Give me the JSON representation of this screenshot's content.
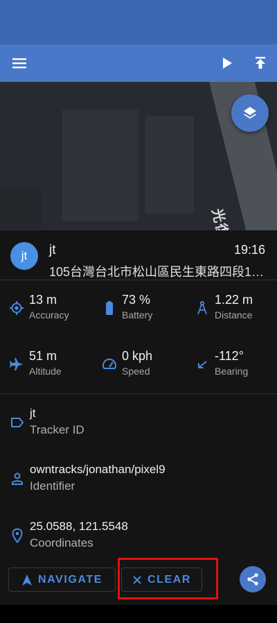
{
  "colors": {
    "primary": "#4a78c8",
    "accent_blue": "#4a8ae0",
    "highlight": "#e01010"
  },
  "toolbar": {
    "icons": [
      "menu-icon",
      "play-icon",
      "upload-icon"
    ]
  },
  "map": {
    "road_label": "光復北路",
    "layers_icon": "layers-icon"
  },
  "contact": {
    "avatar_initials": "jt",
    "name": "jt",
    "time": "19:16",
    "address": "105台灣台北市松山區民生東路四段1…"
  },
  "stats": {
    "accuracy": {
      "value": "13 m",
      "label": "Accuracy",
      "icon": "crosshair-icon"
    },
    "battery": {
      "value": "73 %",
      "label": "Battery",
      "icon": "battery-icon"
    },
    "distance": {
      "value": "1.22 m",
      "label": "Distance",
      "icon": "compass-icon"
    },
    "altitude": {
      "value": "51 m",
      "label": "Altitude",
      "icon": "airplane-icon"
    },
    "speed": {
      "value": "0 kph",
      "label": "Speed",
      "icon": "speedometer-icon"
    },
    "bearing": {
      "value": "-112°",
      "label": "Bearing",
      "icon": "arrow-icon"
    }
  },
  "details": {
    "tracker_id": {
      "value": "jt",
      "label": "Tracker ID",
      "icon": "label-icon"
    },
    "identifier": {
      "value": "owntracks/jonathan/pixel9",
      "label": "Identifier",
      "icon": "person-icon"
    },
    "coordinates": {
      "value": "25.0588, 121.5548",
      "label": "Coordinates",
      "icon": "location-pin-icon"
    }
  },
  "actions": {
    "navigate_label": "NAVIGATE",
    "clear_label": "CLEAR",
    "share_icon": "share-icon"
  }
}
